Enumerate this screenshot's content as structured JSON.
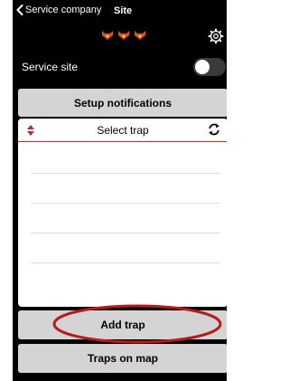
{
  "header": {
    "back_label": "Service company",
    "site_title": "Site"
  },
  "service_site": {
    "label": "Service site",
    "toggle_on": false
  },
  "setup_notifications": {
    "label": "Setup notifications"
  },
  "trap_list": {
    "select_label": "Select trap"
  },
  "add_trap": {
    "label": "Add trap"
  },
  "traps_on_map": {
    "label": "Traps on map"
  },
  "colors": {
    "background": "#000000",
    "button": "#d4d4d4",
    "accent_red": "#c62828",
    "rating_orange": "#e65100"
  },
  "icons": [
    "chevron-left-icon",
    "fox-icon",
    "gear-icon",
    "sort-arrows-icon",
    "refresh-icon"
  ]
}
